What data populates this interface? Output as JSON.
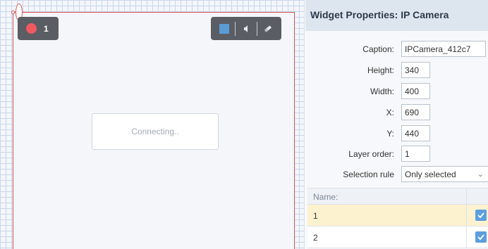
{
  "camera": {
    "record_count": "1",
    "status_text": "Connecting..",
    "controls": [
      "stop-icon",
      "volume-icon",
      "eraser-icon"
    ]
  },
  "properties": {
    "title": "Widget Properties: IP Camera",
    "caption_label": "Caption:",
    "caption_value": "IPCamera_412c7",
    "height_label": "Height:",
    "height_value": "340",
    "width_label": "Width:",
    "width_value": "400",
    "x_label": "X:",
    "x_value": "690",
    "y_label": "Y:",
    "y_value": "440",
    "layer_label": "Layer order:",
    "layer_value": "1",
    "selection_label": "Selection rule",
    "selection_value": "Only selected"
  },
  "layers_table": {
    "header": "Name:",
    "rows": [
      {
        "name": "1",
        "checked": true,
        "selected": true
      },
      {
        "name": "2",
        "checked": true,
        "selected": false
      }
    ]
  },
  "colors": {
    "accent": "#5c9ee0",
    "record": "#f0595f",
    "selection_border": "#d9534f",
    "selected_row": "#fdf2cf"
  }
}
